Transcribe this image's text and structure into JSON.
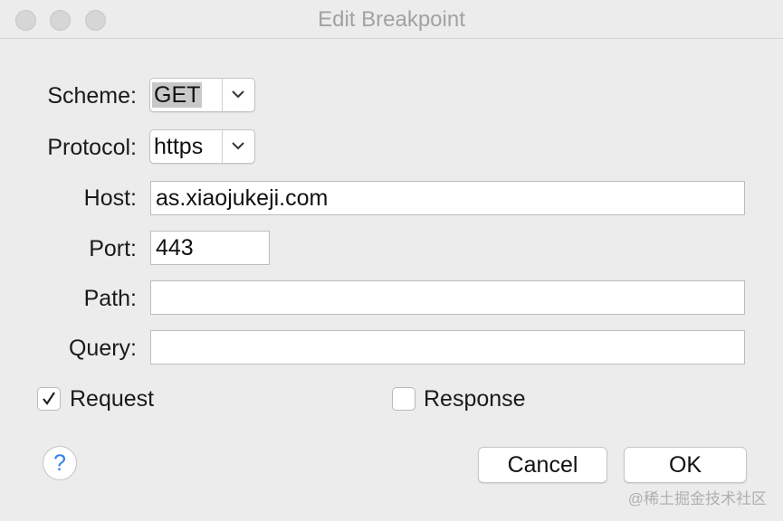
{
  "window": {
    "title": "Edit Breakpoint"
  },
  "form": {
    "scheme": {
      "label": "Scheme:",
      "value": "GET"
    },
    "protocol": {
      "label": "Protocol:",
      "value": "https"
    },
    "host": {
      "label": "Host:",
      "value": "as.xiaojukeji.com"
    },
    "port": {
      "label": "Port:",
      "value": "443"
    },
    "path": {
      "label": "Path:",
      "value": ""
    },
    "query": {
      "label": "Query:",
      "value": ""
    }
  },
  "options": {
    "request": {
      "label": "Request",
      "checked": true
    },
    "response": {
      "label": "Response",
      "checked": false
    }
  },
  "buttons": {
    "help": "?",
    "cancel": "Cancel",
    "ok": "OK"
  },
  "watermark": "@稀土掘金技术社区"
}
